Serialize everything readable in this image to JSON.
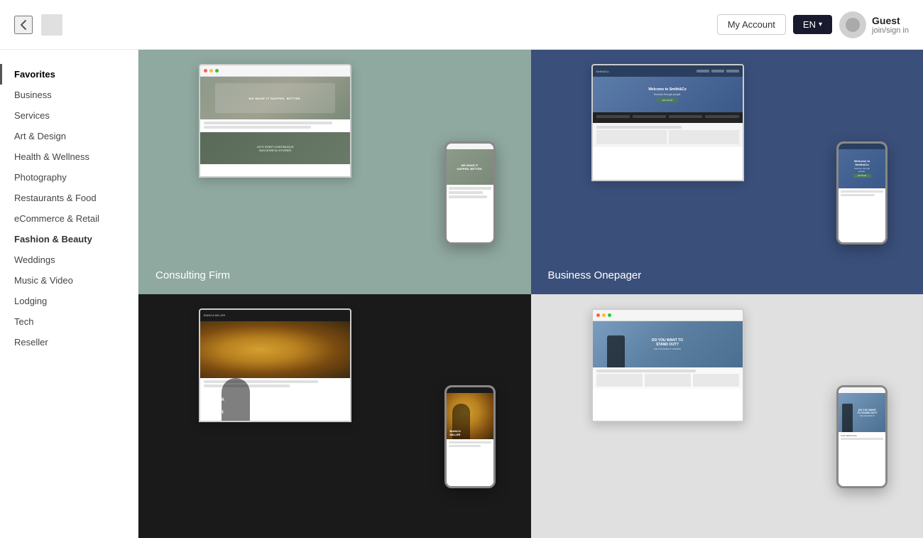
{
  "header": {
    "back_label": "←",
    "my_account_label": "My Account",
    "language_label": "EN",
    "guest_name": "Guest",
    "guest_sub": "join/sign in"
  },
  "sidebar": {
    "items": [
      {
        "id": "favorites",
        "label": "Favorites",
        "active": true
      },
      {
        "id": "business",
        "label": "Business"
      },
      {
        "id": "services",
        "label": "Services"
      },
      {
        "id": "art-design",
        "label": "Art & Design"
      },
      {
        "id": "health-wellness",
        "label": "Health & Wellness"
      },
      {
        "id": "photography",
        "label": "Photography"
      },
      {
        "id": "restaurants-food",
        "label": "Restaurants & Food"
      },
      {
        "id": "ecommerce-retail",
        "label": "eCommerce & Retail"
      },
      {
        "id": "fashion-beauty",
        "label": "Fashion & Beauty",
        "highlighted": true
      },
      {
        "id": "weddings",
        "label": "Weddings"
      },
      {
        "id": "music-video",
        "label": "Music & Video"
      },
      {
        "id": "lodging",
        "label": "Lodging"
      },
      {
        "id": "tech",
        "label": "Tech"
      },
      {
        "id": "reseller",
        "label": "Reseller"
      }
    ]
  },
  "templates": [
    {
      "id": "consulting-firm",
      "label": "Consulting Firm",
      "bg_color": "#8fa8a0",
      "label_color": "#fff"
    },
    {
      "id": "business-onepager",
      "label": "Business Onepager",
      "bg_color": "#3a4f7a",
      "label_color": "#fff"
    },
    {
      "id": "photography-port",
      "label": "",
      "bg_color": "#1a1a1a",
      "label_color": "#fff"
    },
    {
      "id": "services-template",
      "label": "",
      "bg_color": "#e0e0e0",
      "label_color": "#333"
    }
  ],
  "mockup": {
    "consulting_hero_text": "WE MAKE IT HAPPEN. BETTER.",
    "consulting_cta": "LETS START CONTINUOUS SUCCESSFUL STORIES",
    "smithco_logo": "Welcome to\nSmith&Co",
    "smithco_tagline": "Success through\npeople.",
    "bianca_name": "BIANCA\nMILLER",
    "services_hero": "DO YOU WANT TO\nSTAND OUT?"
  }
}
